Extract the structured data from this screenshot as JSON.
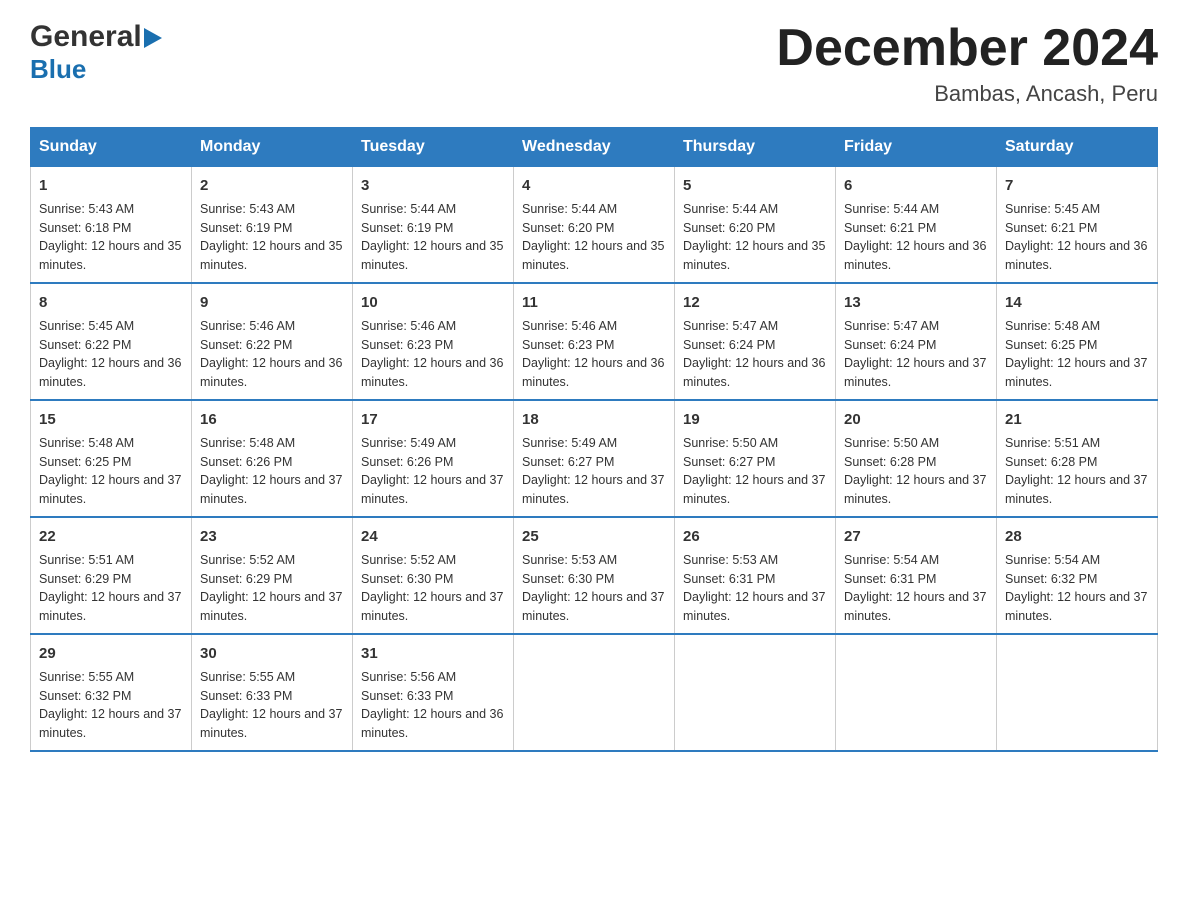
{
  "logo": {
    "line1": "General",
    "arrow": "▶",
    "line2": "Blue"
  },
  "title": "December 2024",
  "subtitle": "Bambas, Ancash, Peru",
  "days_header": [
    "Sunday",
    "Monday",
    "Tuesday",
    "Wednesday",
    "Thursday",
    "Friday",
    "Saturday"
  ],
  "weeks": [
    [
      {
        "day": "1",
        "sunrise": "5:43 AM",
        "sunset": "6:18 PM",
        "daylight": "12 hours and 35 minutes."
      },
      {
        "day": "2",
        "sunrise": "5:43 AM",
        "sunset": "6:19 PM",
        "daylight": "12 hours and 35 minutes."
      },
      {
        "day": "3",
        "sunrise": "5:44 AM",
        "sunset": "6:19 PM",
        "daylight": "12 hours and 35 minutes."
      },
      {
        "day": "4",
        "sunrise": "5:44 AM",
        "sunset": "6:20 PM",
        "daylight": "12 hours and 35 minutes."
      },
      {
        "day": "5",
        "sunrise": "5:44 AM",
        "sunset": "6:20 PM",
        "daylight": "12 hours and 35 minutes."
      },
      {
        "day": "6",
        "sunrise": "5:44 AM",
        "sunset": "6:21 PM",
        "daylight": "12 hours and 36 minutes."
      },
      {
        "day": "7",
        "sunrise": "5:45 AM",
        "sunset": "6:21 PM",
        "daylight": "12 hours and 36 minutes."
      }
    ],
    [
      {
        "day": "8",
        "sunrise": "5:45 AM",
        "sunset": "6:22 PM",
        "daylight": "12 hours and 36 minutes."
      },
      {
        "day": "9",
        "sunrise": "5:46 AM",
        "sunset": "6:22 PM",
        "daylight": "12 hours and 36 minutes."
      },
      {
        "day": "10",
        "sunrise": "5:46 AM",
        "sunset": "6:23 PM",
        "daylight": "12 hours and 36 minutes."
      },
      {
        "day": "11",
        "sunrise": "5:46 AM",
        "sunset": "6:23 PM",
        "daylight": "12 hours and 36 minutes."
      },
      {
        "day": "12",
        "sunrise": "5:47 AM",
        "sunset": "6:24 PM",
        "daylight": "12 hours and 36 minutes."
      },
      {
        "day": "13",
        "sunrise": "5:47 AM",
        "sunset": "6:24 PM",
        "daylight": "12 hours and 37 minutes."
      },
      {
        "day": "14",
        "sunrise": "5:48 AM",
        "sunset": "6:25 PM",
        "daylight": "12 hours and 37 minutes."
      }
    ],
    [
      {
        "day": "15",
        "sunrise": "5:48 AM",
        "sunset": "6:25 PM",
        "daylight": "12 hours and 37 minutes."
      },
      {
        "day": "16",
        "sunrise": "5:48 AM",
        "sunset": "6:26 PM",
        "daylight": "12 hours and 37 minutes."
      },
      {
        "day": "17",
        "sunrise": "5:49 AM",
        "sunset": "6:26 PM",
        "daylight": "12 hours and 37 minutes."
      },
      {
        "day": "18",
        "sunrise": "5:49 AM",
        "sunset": "6:27 PM",
        "daylight": "12 hours and 37 minutes."
      },
      {
        "day": "19",
        "sunrise": "5:50 AM",
        "sunset": "6:27 PM",
        "daylight": "12 hours and 37 minutes."
      },
      {
        "day": "20",
        "sunrise": "5:50 AM",
        "sunset": "6:28 PM",
        "daylight": "12 hours and 37 minutes."
      },
      {
        "day": "21",
        "sunrise": "5:51 AM",
        "sunset": "6:28 PM",
        "daylight": "12 hours and 37 minutes."
      }
    ],
    [
      {
        "day": "22",
        "sunrise": "5:51 AM",
        "sunset": "6:29 PM",
        "daylight": "12 hours and 37 minutes."
      },
      {
        "day": "23",
        "sunrise": "5:52 AM",
        "sunset": "6:29 PM",
        "daylight": "12 hours and 37 minutes."
      },
      {
        "day": "24",
        "sunrise": "5:52 AM",
        "sunset": "6:30 PM",
        "daylight": "12 hours and 37 minutes."
      },
      {
        "day": "25",
        "sunrise": "5:53 AM",
        "sunset": "6:30 PM",
        "daylight": "12 hours and 37 minutes."
      },
      {
        "day": "26",
        "sunrise": "5:53 AM",
        "sunset": "6:31 PM",
        "daylight": "12 hours and 37 minutes."
      },
      {
        "day": "27",
        "sunrise": "5:54 AM",
        "sunset": "6:31 PM",
        "daylight": "12 hours and 37 minutes."
      },
      {
        "day": "28",
        "sunrise": "5:54 AM",
        "sunset": "6:32 PM",
        "daylight": "12 hours and 37 minutes."
      }
    ],
    [
      {
        "day": "29",
        "sunrise": "5:55 AM",
        "sunset": "6:32 PM",
        "daylight": "12 hours and 37 minutes."
      },
      {
        "day": "30",
        "sunrise": "5:55 AM",
        "sunset": "6:33 PM",
        "daylight": "12 hours and 37 minutes."
      },
      {
        "day": "31",
        "sunrise": "5:56 AM",
        "sunset": "6:33 PM",
        "daylight": "12 hours and 36 minutes."
      },
      null,
      null,
      null,
      null
    ]
  ]
}
